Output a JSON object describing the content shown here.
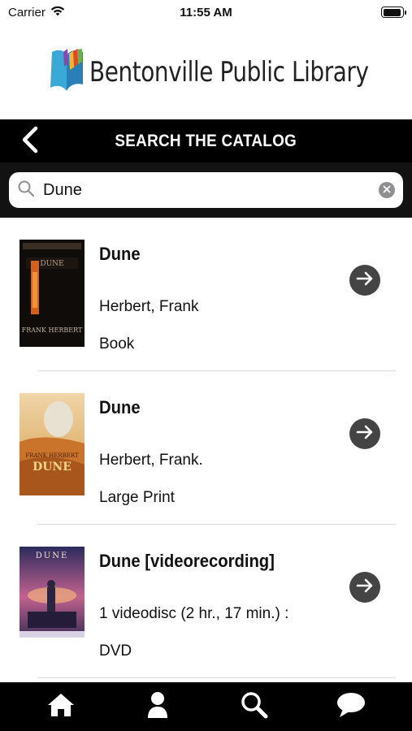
{
  "status": {
    "carrier": "Carrier",
    "time": "11:55 AM",
    "battery_level": 0.95
  },
  "header": {
    "logo_text": "Bentonville Public Library",
    "logo_icon": "book-logo-icon"
  },
  "topbar": {
    "title": "SEARCH THE CATALOG",
    "back_icon": "chevron-left-icon"
  },
  "search": {
    "value": "Dune",
    "placeholder": "",
    "search_icon": "search-icon",
    "clear_icon": "clear-icon"
  },
  "results": [
    {
      "title": "Dune",
      "author": "Herbert, Frank",
      "format": "Book",
      "cover_icon": "book-cover-image",
      "cover_text_top": "DUNE",
      "cover_text_bottom": "FRANK HERBERT"
    },
    {
      "title": "Dune",
      "author": "Herbert, Frank.",
      "format": "Large Print",
      "cover_icon": "book-cover-image",
      "cover_text_top": "FRANK HERBERT",
      "cover_text_bottom": "DUNE"
    },
    {
      "title": "Dune [videorecording]",
      "author": "1 videodisc (2 hr., 17 min.) :",
      "format": "DVD",
      "cover_icon": "dvd-cover-image",
      "cover_text_top": "DUNE",
      "cover_text_bottom": ""
    }
  ],
  "tabbar": {
    "tabs": [
      {
        "name": "home",
        "icon": "home-icon"
      },
      {
        "name": "account",
        "icon": "person-icon"
      },
      {
        "name": "search",
        "icon": "search-icon"
      },
      {
        "name": "chat",
        "icon": "chat-icon"
      }
    ]
  },
  "colors": {
    "bar_black": "#000000",
    "search_bg": "#121212",
    "arrow_button": "#444444",
    "divider": "#dddddd"
  }
}
